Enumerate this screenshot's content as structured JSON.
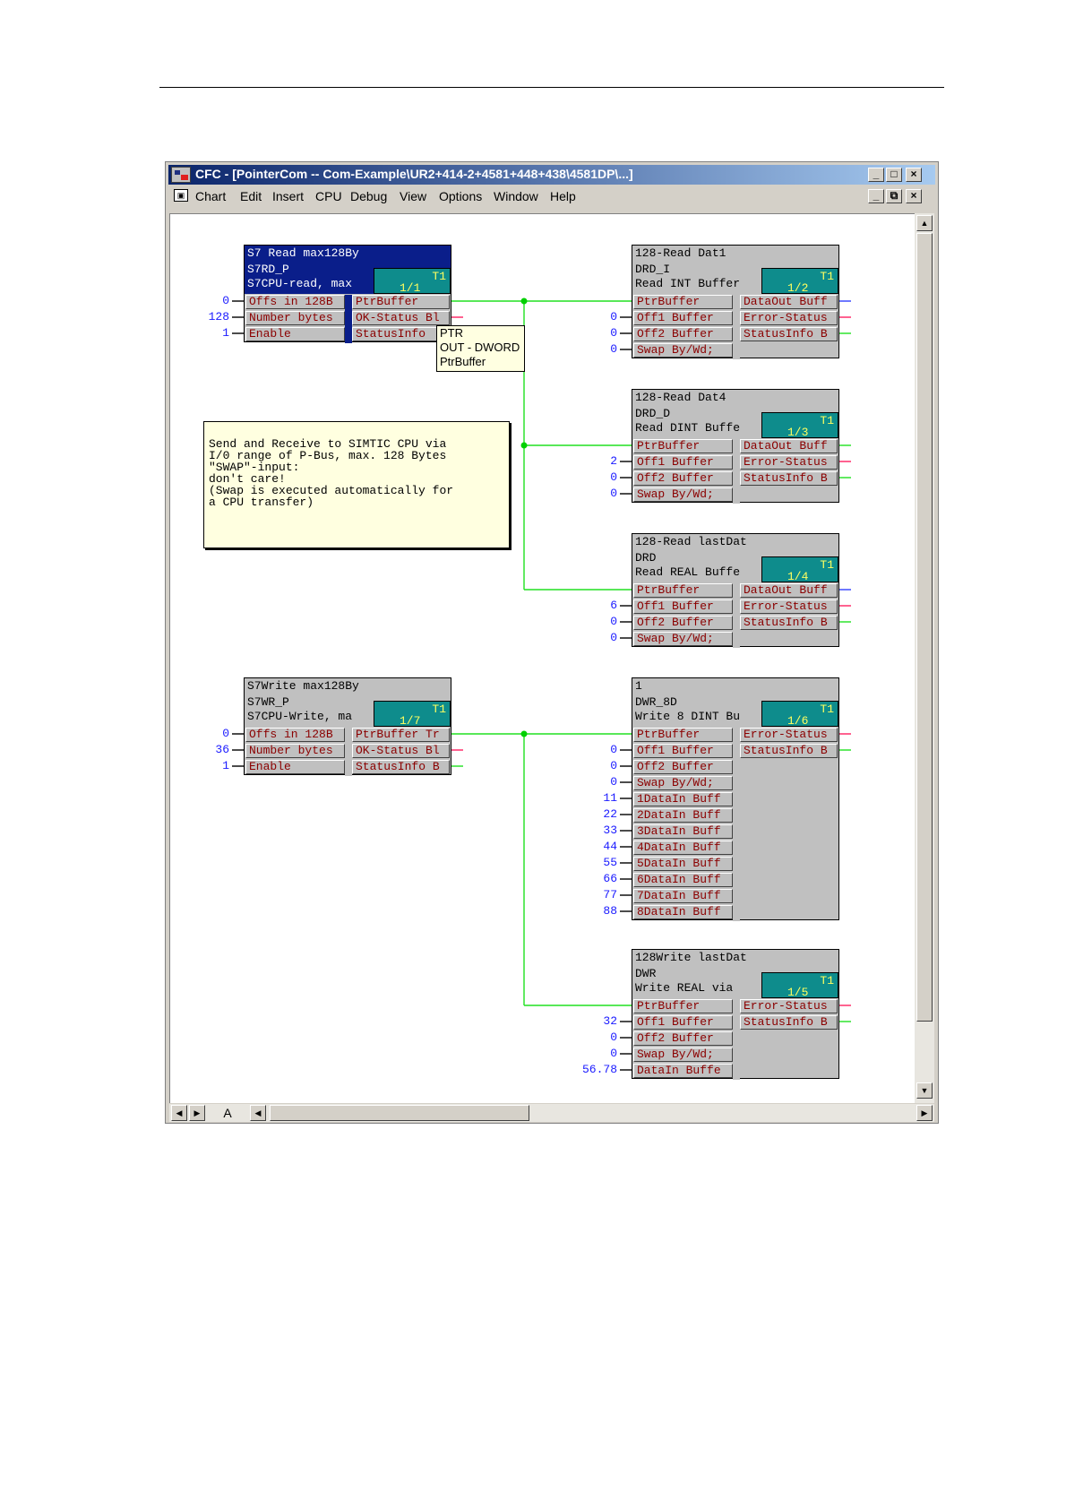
{
  "window": {
    "title": "CFC - [PointerCom -- Com-Example\\UR2+414-2+4581+448+438\\4581DP\\...]",
    "controls": [
      "_",
      "□",
      "×"
    ],
    "doc_controls": [
      "_",
      "⧉",
      "×"
    ]
  },
  "menu": [
    "Chart",
    "Edit",
    "Insert",
    "CPU",
    "Debug",
    "View",
    "Options",
    "Window",
    "Help"
  ],
  "sheet_tab": "A",
  "tooltip": [
    "PTR",
    "OUT - DWORD",
    "PtrBuffer"
  ],
  "note": [
    "Send and Receive to SIMTIC CPU via",
    "I/0 range of P-Bus, max. 128 Bytes",
    "",
    "\"SWAP\"-input:",
    "don't care!",
    "(Swap is executed automatically for",
    "a CPU transfer)"
  ],
  "blocks": [
    {
      "name": "S7 Read max128By",
      "type": "S7RD_P",
      "comment": "S7CPU-read, max",
      "task": "T1",
      "seq": "1/1",
      "inputs": [
        {
          "label": "Offs in 128B",
          "value": "0"
        },
        {
          "label": "Number bytes",
          "value": "128"
        },
        {
          "label": "Enable",
          "value": "1"
        }
      ],
      "outputs": [
        "PtrBuffer",
        "OK-Status Bl",
        "StatusInfo"
      ]
    },
    {
      "name": "128-Read Dat1",
      "type": "DRD_I",
      "comment": "Read INT Buffer",
      "task": "T1",
      "seq": "1/2",
      "inputs": [
        {
          "label": "PtrBuffer",
          "value": ""
        },
        {
          "label": "Off1 Buffer",
          "value": "0"
        },
        {
          "label": "Off2 Buffer",
          "value": "0"
        },
        {
          "label": "Swap By/Wd;",
          "value": "0"
        }
      ],
      "outputs": [
        "DataOut Buff",
        "Error-Status",
        "StatusInfo B"
      ]
    },
    {
      "name": "128-Read Dat4",
      "type": "DRD_D",
      "comment": "Read DINT Buffe",
      "task": "T1",
      "seq": "1/3",
      "inputs": [
        {
          "label": "PtrBuffer",
          "value": ""
        },
        {
          "label": "Off1 Buffer",
          "value": "2"
        },
        {
          "label": "Off2 Buffer",
          "value": "0"
        },
        {
          "label": "Swap By/Wd;",
          "value": "0"
        }
      ],
      "outputs": [
        "DataOut Buff",
        "Error-Status",
        "StatusInfo B"
      ]
    },
    {
      "name": "128-Read lastDat",
      "type": "DRD",
      "comment": "Read REAL Buffe",
      "task": "T1",
      "seq": "1/4",
      "inputs": [
        {
          "label": "PtrBuffer",
          "value": ""
        },
        {
          "label": "Off1 Buffer",
          "value": "6"
        },
        {
          "label": "Off2 Buffer",
          "value": "0"
        },
        {
          "label": "Swap By/Wd;",
          "value": "0"
        }
      ],
      "outputs": [
        "DataOut Buff",
        "Error-Status",
        "StatusInfo B"
      ]
    },
    {
      "name": "S7Write max128By",
      "type": "S7WR_P",
      "comment": "S7CPU-Write, ma",
      "task": "T1",
      "seq": "1/7",
      "inputs": [
        {
          "label": "Offs in 128B",
          "value": "0"
        },
        {
          "label": "Number bytes",
          "value": "36"
        },
        {
          "label": "Enable",
          "value": "1"
        }
      ],
      "outputs": [
        "PtrBuffer Tr",
        "OK-Status Bl",
        "StatusInfo B"
      ]
    },
    {
      "name": "1",
      "type": "DWR_8D",
      "comment": "Write 8 DINT Bu",
      "task": "T1",
      "seq": "1/6",
      "inputs": [
        {
          "label": "PtrBuffer",
          "value": ""
        },
        {
          "label": "Off1 Buffer",
          "value": "0"
        },
        {
          "label": "Off2 Buffer",
          "value": "0"
        },
        {
          "label": "Swap By/Wd;",
          "value": "0"
        },
        {
          "label": "1DataIn Buff",
          "value": "11"
        },
        {
          "label": "2DataIn Buff",
          "value": "22"
        },
        {
          "label": "3DataIn Buff",
          "value": "33"
        },
        {
          "label": "4DataIn Buff",
          "value": "44"
        },
        {
          "label": "5DataIn Buff",
          "value": "55"
        },
        {
          "label": "6DataIn Buff",
          "value": "66"
        },
        {
          "label": "7DataIn Buff",
          "value": "77"
        },
        {
          "label": "8DataIn Buff",
          "value": "88"
        }
      ],
      "outputs": [
        "Error-Status",
        "StatusInfo B"
      ]
    },
    {
      "name": "128Write lastDat",
      "type": "DWR",
      "comment": "Write REAL via",
      "task": "T1",
      "seq": "1/5",
      "inputs": [
        {
          "label": "PtrBuffer",
          "value": ""
        },
        {
          "label": "Off1 Buffer",
          "value": "32"
        },
        {
          "label": "Off2 Buffer",
          "value": "0"
        },
        {
          "label": "Swap By/Wd;",
          "value": "0"
        },
        {
          "label": "DataIn Buffe",
          "value": "56.78"
        }
      ],
      "outputs": [
        "Error-Status",
        "StatusInfo B"
      ]
    }
  ]
}
